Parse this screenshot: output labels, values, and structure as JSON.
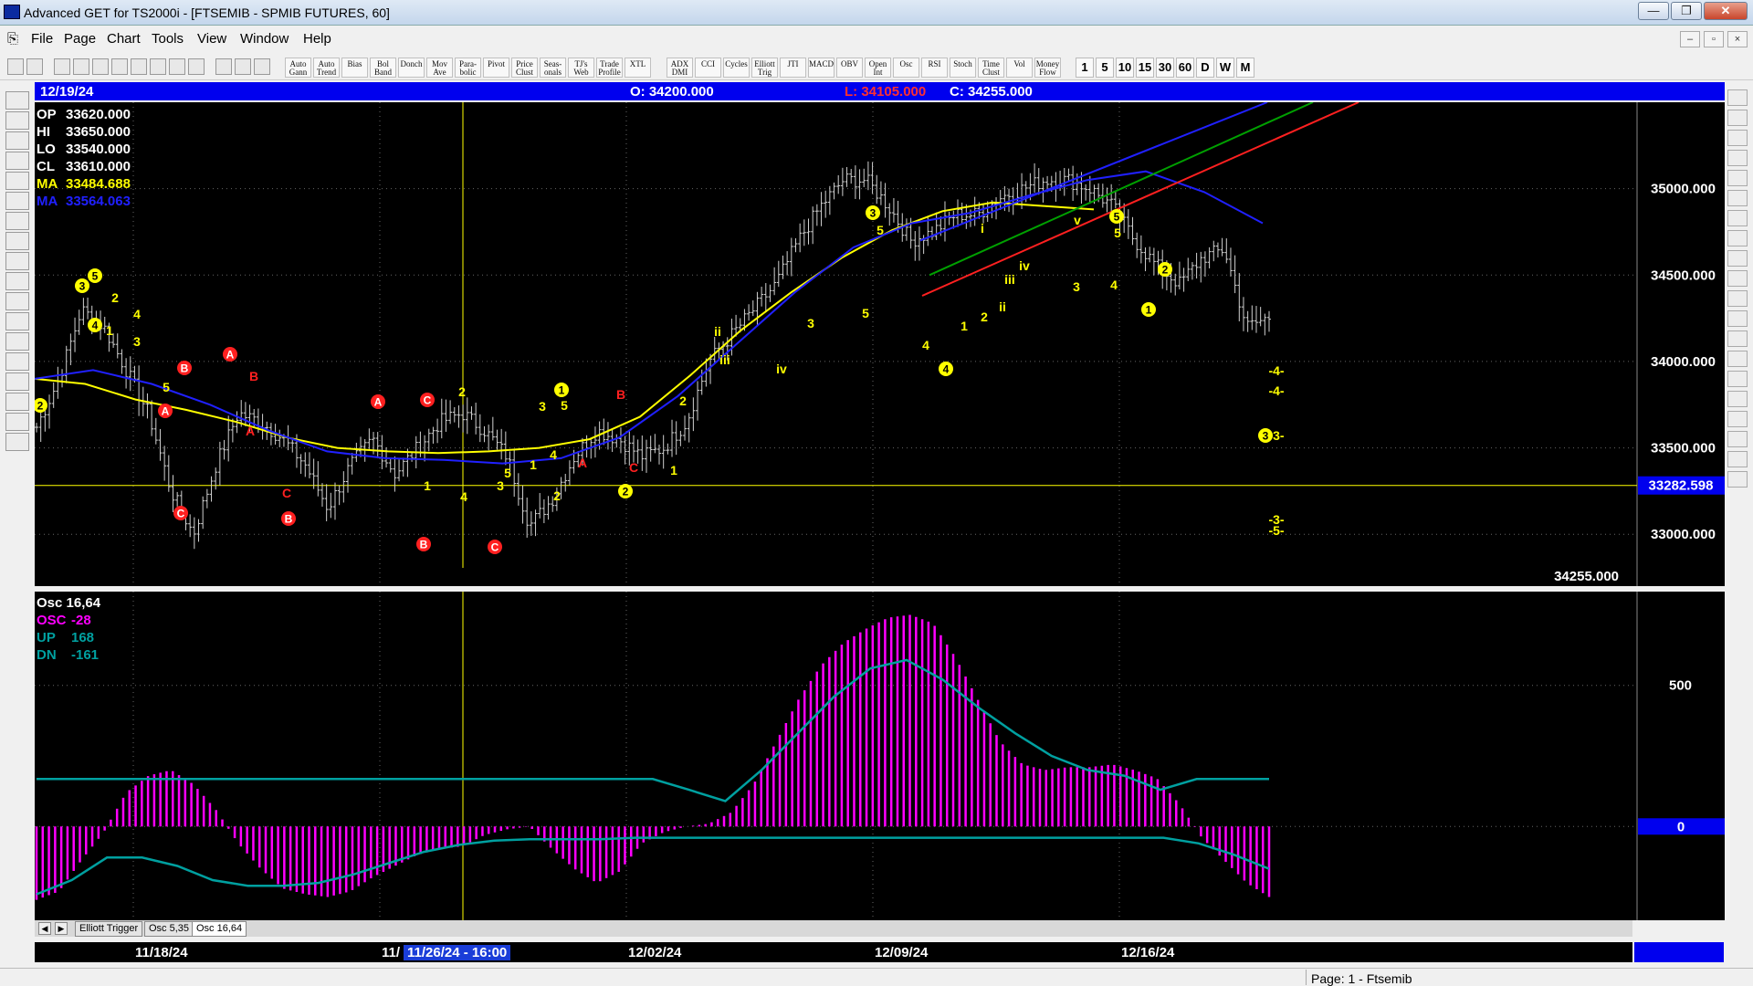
{
  "window": {
    "title": "Advanced GET for TS2000i - [FTSEMIB - SPMIB FUTURES, 60]",
    "buttons": [
      "—",
      "❐",
      "✕"
    ]
  },
  "menu": [
    "File",
    "Page",
    "Chart",
    "Tools",
    "View",
    "Window",
    "Help"
  ],
  "mdi_buttons": [
    "–",
    "▫",
    "×"
  ],
  "toolbar": {
    "study_buttons": [
      "Auto Gann",
      "Auto Trend",
      "Bias",
      "Bol Band",
      "Donch",
      "Mov Ave",
      "Para-bolic",
      "Pivot",
      "Price Clust",
      "Seas-onals",
      "TJ's Web",
      "Trade Profile",
      "XTL"
    ],
    "indicator_buttons": [
      "ADX DMI",
      "CCI",
      "Cycles",
      "Elliott Trig",
      "JTI",
      "MACD",
      "OBV",
      "Open Int",
      "Osc",
      "RSI",
      "Stoch",
      "Time Clust",
      "Vol",
      "Money Flow"
    ],
    "interval_buttons": [
      "1",
      "5",
      "10",
      "15",
      "30",
      "60",
      "D",
      "W",
      "M"
    ]
  },
  "info_bar": {
    "date": "12/19/24",
    "open": "O: 34200.000",
    "low": "L: 34105.000",
    "close": "C: 34255.000"
  },
  "price_legend": [
    {
      "label": "OP",
      "value": "33620.000",
      "color": "#ffffff"
    },
    {
      "label": "HI",
      "value": "33650.000",
      "color": "#ffffff"
    },
    {
      "label": "LO",
      "value": "33540.000",
      "color": "#ffffff"
    },
    {
      "label": "CL",
      "value": "33610.000",
      "color": "#ffffff"
    },
    {
      "label": "MA",
      "value": "33484.688",
      "color": "#ffff00"
    },
    {
      "label": "MA",
      "value": "33564.063",
      "color": "#2020ff"
    }
  ],
  "osc_legend": [
    {
      "label": "Osc 16,64",
      "value": "",
      "color": "#ffffff"
    },
    {
      "label": "OSC",
      "value": "-28",
      "color": "#ff00ff"
    },
    {
      "label": "UP",
      "value": "168",
      "color": "#00a0a0"
    },
    {
      "label": "DN",
      "value": "-161",
      "color": "#00a0a0"
    }
  ],
  "price_axis": {
    "ticks": [
      "35000.000",
      "34500.000",
      "34000.000",
      "33500.000",
      "33000.000"
    ],
    "cursor_label": "33282.598",
    "last_price_label": "34255.000"
  },
  "osc_axis": {
    "ticks": [
      "500"
    ],
    "zero_label": "0"
  },
  "tabs": [
    "Elliott Trigger",
    "Osc 5,35",
    "Osc 16,64"
  ],
  "date_axis": {
    "labels": [
      "11/18/24",
      "11/",
      "12/02/24",
      "12/09/24",
      "12/16/24"
    ],
    "cursor_label": "11/26/24 - 16:00"
  },
  "status": {
    "page": "Page: 1 - Ftsemib"
  },
  "wave_labels": [
    {
      "text": "2",
      "style": "circle-yellow"
    },
    {
      "text": "3",
      "style": "circle-yellow"
    },
    {
      "text": "5",
      "style": "circle-yellow"
    },
    {
      "text": "4",
      "style": "circle-yellow"
    },
    {
      "text": "1",
      "style": "yellow"
    },
    {
      "text": "2",
      "style": "yellow"
    },
    {
      "text": "4",
      "style": "yellow"
    },
    {
      "text": "3",
      "style": "yellow"
    },
    {
      "text": "5",
      "style": "yellow"
    },
    {
      "text": "A",
      "style": "circle-red"
    },
    {
      "text": "B",
      "style": "circle-red"
    },
    {
      "text": "C",
      "style": "circle-red"
    },
    {
      "text": "A",
      "style": "circle-red"
    },
    {
      "text": "B",
      "style": "red"
    },
    {
      "text": "A",
      "style": "red"
    },
    {
      "text": "C",
      "style": "red"
    },
    {
      "text": "B",
      "style": "circle-red"
    },
    {
      "text": "C",
      "style": "circle-red"
    },
    {
      "text": "A",
      "style": "circle-red"
    },
    {
      "text": "B",
      "style": "circle-red"
    },
    {
      "text": "1",
      "style": "yellow"
    },
    {
      "text": "2",
      "style": "yellow"
    },
    {
      "text": "4",
      "style": "yellow"
    },
    {
      "text": "3",
      "style": "yellow"
    },
    {
      "text": "5",
      "style": "yellow"
    },
    {
      "text": "1",
      "style": "yellow"
    },
    {
      "text": "2",
      "style": "yellow"
    },
    {
      "text": "C",
      "style": "circle-red"
    },
    {
      "text": "3",
      "style": "yellow"
    },
    {
      "text": "1",
      "style": "circle-yellow"
    },
    {
      "text": "5",
      "style": "yellow"
    },
    {
      "text": "4",
      "style": "yellow"
    },
    {
      "text": "A",
      "style": "red"
    },
    {
      "text": "B",
      "style": "red"
    },
    {
      "text": "C",
      "style": "red"
    },
    {
      "text": "2",
      "style": "circle-yellow"
    },
    {
      "text": "1",
      "style": "yellow"
    },
    {
      "text": "2",
      "style": "yellow"
    },
    {
      "text": "ii",
      "style": "yellow"
    },
    {
      "text": "iii",
      "style": "yellow"
    },
    {
      "text": "iv",
      "style": "yellow"
    },
    {
      "text": "3",
      "style": "yellow"
    },
    {
      "text": "5",
      "style": "yellow"
    },
    {
      "text": "3",
      "style": "circle-yellow"
    },
    {
      "text": "5",
      "style": "yellow"
    },
    {
      "text": "4",
      "style": "yellow"
    },
    {
      "text": "4",
      "style": "circle-yellow"
    },
    {
      "text": "1",
      "style": "yellow"
    },
    {
      "text": "2",
      "style": "yellow"
    },
    {
      "text": "i",
      "style": "yellow"
    },
    {
      "text": "ii",
      "style": "yellow"
    },
    {
      "text": "iii",
      "style": "yellow"
    },
    {
      "text": "iv",
      "style": "yellow"
    },
    {
      "text": "3",
      "style": "yellow"
    },
    {
      "text": "v",
      "style": "yellow"
    },
    {
      "text": "5",
      "style": "circle-yellow"
    },
    {
      "text": "5",
      "style": "yellow"
    },
    {
      "text": "4",
      "style": "yellow"
    },
    {
      "text": "2",
      "style": "circle-yellow"
    },
    {
      "text": "1",
      "style": "circle-yellow"
    },
    {
      "text": "-4-",
      "style": "yellow"
    },
    {
      "text": "-4-",
      "style": "yellow"
    },
    {
      "text": "-3-",
      "style": "yellow"
    },
    {
      "text": "3",
      "style": "circle-yellow"
    },
    {
      "text": "-3-",
      "style": "yellow"
    },
    {
      "text": "-5-",
      "style": "yellow"
    }
  ],
  "chart_data": [
    {
      "type": "line",
      "title": "FTSEMIB - SPMIB FUTURES, 60",
      "y_scale": "price",
      "ylim": [
        32700,
        35500
      ],
      "x_range": [
        "11/13/24",
        "12/19/24"
      ],
      "x_labels": [
        "11/18/24",
        "12/02/24",
        "12/09/24",
        "12/16/24"
      ],
      "series": [
        {
          "name": "",
          "style": "ohlc-bars",
          "color": "#e0e0e0",
          "x": "session bars",
          "close_path": [
            33620,
            33900,
            34300,
            34200,
            33950,
            33700,
            33250,
            33000,
            33400,
            33700,
            33650,
            33550,
            33400,
            33150,
            33400,
            33550,
            33350,
            33500,
            33650,
            33700,
            33600,
            33450,
            33050,
            33200,
            33450,
            33600,
            33550,
            33450,
            33500,
            33650,
            34000,
            34150,
            34300,
            34450,
            34700,
            34900,
            35050,
            35050,
            34900,
            34700,
            34750,
            34850,
            34850,
            34950,
            35000,
            35050,
            35050,
            35000,
            34900,
            34700,
            34550,
            34450,
            34600,
            34650,
            34200,
            34255
          ]
        },
        {
          "name": "",
          "style": "line",
          "color": "#ffff00",
          "values": [
            33900,
            33870,
            33780,
            33720,
            33650,
            33560,
            33500,
            33480,
            33470,
            33480,
            33500,
            33550,
            33680,
            33920,
            34180,
            34400,
            34600,
            34760,
            34870,
            34920,
            34900,
            34880
          ]
        },
        {
          "name": "",
          "style": "line",
          "color": "#2020ff",
          "values": [
            33900,
            33950,
            33870,
            33750,
            33600,
            33480,
            33440,
            33430,
            33410,
            33440,
            33560,
            33800,
            34100,
            34400,
            34660,
            34800,
            34860,
            34960,
            35050,
            35100,
            34980,
            34800
          ]
        }
      ],
      "horizontal_line": {
        "value": 33282.598,
        "color": "#ffff00"
      },
      "trend_channel": [
        {
          "color": "#2020ff",
          "from": 34700,
          "to": 35500
        },
        {
          "color": "#00a000",
          "from": 34500,
          "to": 35500
        },
        {
          "color": "#ff2020",
          "from": 34380,
          "to": 35500
        }
      ],
      "grid": true
    },
    {
      "type": "bar",
      "title": "Osc 16,64",
      "ylim": [
        -300,
        800
      ],
      "series": [
        {
          "name": "OSC",
          "color": "#ff00ff",
          "values": [
            -260,
            -230,
            -120,
            -20,
            120,
            180,
            200,
            150,
            60,
            -60,
            -150,
            -220,
            -240,
            -250,
            -230,
            -180,
            -140,
            -100,
            -80,
            -70,
            -30,
            -10,
            0,
            -80,
            -150,
            -200,
            -160,
            -60,
            -20,
            0,
            10,
            50,
            150,
            300,
            450,
            570,
            650,
            700,
            740,
            750,
            720,
            600,
            450,
            300,
            220,
            200,
            210,
            210,
            220,
            200,
            170,
            80,
            -40,
            -120,
            -200,
            -250
          ]
        },
        {
          "name": "UP",
          "color": "#00a0a0",
          "values": [
            168,
            168,
            168,
            168,
            168,
            168,
            168,
            168,
            168,
            168,
            168,
            168,
            168,
            168,
            168,
            168,
            168,
            168,
            130,
            90,
            200,
            330,
            460,
            560,
            590,
            520,
            420,
            330,
            250,
            200,
            180,
            130,
            168,
            168,
            168
          ]
        },
        {
          "name": "DN",
          "color": "#00a0a0",
          "values": [
            -240,
            -190,
            -110,
            -110,
            -140,
            -190,
            -210,
            -210,
            -200,
            -170,
            -130,
            -90,
            -65,
            -50,
            -45,
            -45,
            -45,
            -40,
            -40,
            -40,
            -40,
            -40,
            -40,
            -40,
            -40,
            -40,
            -40,
            -40,
            -40,
            -40,
            -40,
            -40,
            -40,
            -60,
            -100,
            -150
          ]
        }
      ],
      "grid": true
    }
  ]
}
